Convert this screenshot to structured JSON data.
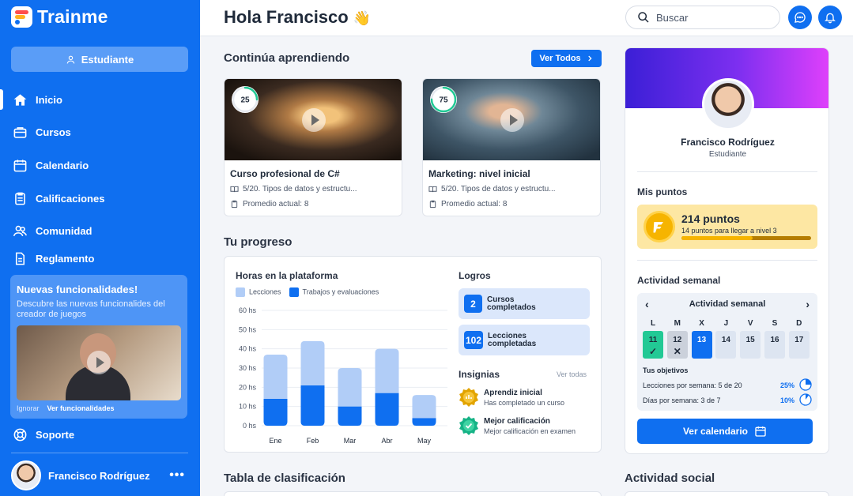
{
  "app": {
    "name": "Trainme"
  },
  "sidebar": {
    "role_button": "Estudiante",
    "items": [
      {
        "label": "Inicio"
      },
      {
        "label": "Cursos"
      },
      {
        "label": "Calendario"
      },
      {
        "label": "Calificaciones"
      },
      {
        "label": "Comunidad"
      },
      {
        "label": "Reglamento"
      },
      {
        "label": "Soporte"
      }
    ],
    "promo": {
      "title": "Nuevas funcionalidades!",
      "text": "Descubre las nuevas funcionalides del creador de juegos",
      "ignore": "Ignorar",
      "see": "Ver funcionalidades"
    },
    "user": {
      "name": "Francisco Rodríguez",
      "more": "•••"
    }
  },
  "header": {
    "greeting": "Hola Francisco",
    "emoji": "👋",
    "search_placeholder": "Buscar"
  },
  "continue": {
    "title": "Continúa aprendiendo",
    "see_all": "Ver Todos",
    "courses": [
      {
        "title": "Curso profesional de C#",
        "progress": 25,
        "lesson": "5/20. Tipos de datos y estructu...",
        "avg": "Promedio actual: 8"
      },
      {
        "title": "Marketing: nivel inicial",
        "progress": 75,
        "lesson": "5/20. Tipos de datos y estructu...",
        "avg": "Promedio actual: 8"
      }
    ]
  },
  "progress": {
    "title": "Tu progreso",
    "chart_title": "Horas en la plataforma",
    "legend": [
      "Lecciones",
      "Trabajos y evaluaciones"
    ],
    "logros_title": "Logros",
    "logros": [
      {
        "num": "2",
        "label": "Cursos completados"
      },
      {
        "num": "102",
        "label": "Lecciones completadas"
      }
    ],
    "insignias_title": "Insignias",
    "insignias_all": "Ver todas",
    "badges": [
      {
        "title": "Aprendiz inicial",
        "desc": "Has completado un curso"
      },
      {
        "title": "Mejor calificación",
        "desc": "Mejor calificación en examen"
      }
    ]
  },
  "chart_data": {
    "type": "bar",
    "stacked": true,
    "categories": [
      "Ene",
      "Feb",
      "Mar",
      "Abr",
      "May"
    ],
    "series": [
      {
        "name": "Trabajos y evaluaciones",
        "values": [
          14,
          21,
          10,
          17,
          4
        ],
        "color": "#0f6ff0"
      },
      {
        "name": "Lecciones",
        "values": [
          23,
          23,
          20,
          23,
          12
        ],
        "color": "#b1cdf7"
      }
    ],
    "yticks": [
      "0 hs",
      "10 hs",
      "20 hs",
      "30 hs",
      "40 hs",
      "50 hs",
      "60 hs"
    ],
    "ylim": [
      0,
      60
    ],
    "grid": true
  },
  "profile": {
    "name": "Francisco Rodríguez",
    "role": "Estudiante",
    "points_title": "Mis puntos",
    "points": "214 puntos",
    "points_sub": "14 puntos para llegar a nivel 3",
    "points_progress": 0.55,
    "weekly_title": "Actividad semanal",
    "week": {
      "header": "Actividad semanal",
      "prev": "‹",
      "next": "›",
      "days": [
        {
          "letter": "L",
          "num": "11",
          "state": "done",
          "mark": "✓"
        },
        {
          "letter": "M",
          "num": "12",
          "state": "miss",
          "mark": "✕"
        },
        {
          "letter": "X",
          "num": "13",
          "state": "today",
          "mark": ""
        },
        {
          "letter": "J",
          "num": "14",
          "state": "future",
          "mark": ""
        },
        {
          "letter": "V",
          "num": "15",
          "state": "future",
          "mark": ""
        },
        {
          "letter": "S",
          "num": "16",
          "state": "future",
          "mark": ""
        },
        {
          "letter": "D",
          "num": "17",
          "state": "future",
          "mark": ""
        }
      ],
      "objectives_title": "Tus objetivos",
      "objectives": [
        {
          "label": "Lecciones por semana: 5 de 20",
          "pct": "25%",
          "fraction": 0.25
        },
        {
          "label": "Días por semana: 3 de 7",
          "pct": "10%",
          "fraction": 0.1
        }
      ]
    },
    "calendar_button": "Ver calendario"
  },
  "bottom": {
    "leaderboard": "Tabla de clasificación",
    "social": "Actividad social"
  },
  "colors": {
    "primary": "#0f6ff0",
    "success": "#22c995",
    "gold": "#f6b400"
  }
}
